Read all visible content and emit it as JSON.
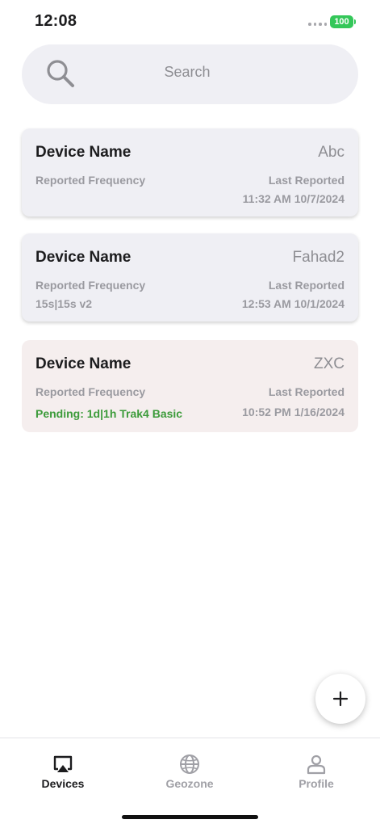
{
  "status_bar": {
    "time": "12:08",
    "battery": "100"
  },
  "search": {
    "placeholder": "Search"
  },
  "devices": [
    {
      "title": "Device Name",
      "name": "Abc",
      "frequency_label": "Reported Frequency",
      "frequency_value": "",
      "last_label": "Last Reported",
      "last_value": "11:32 AM 10/7/2024"
    },
    {
      "title": "Device Name",
      "name": "Fahad2",
      "frequency_label": "Reported Frequency",
      "frequency_value": "15s|15s v2",
      "last_label": "Last Reported",
      "last_value": "12:53 AM 10/1/2024"
    },
    {
      "title": "Device Name",
      "name": "ZXC",
      "frequency_label": "Reported Frequency",
      "frequency_value": "Pending: 1d|1h Trak4 Basic",
      "last_label": "Last Reported",
      "last_value": "10:52 PM 1/16/2024",
      "pending": true
    }
  ],
  "tabs": [
    {
      "label": "Devices",
      "icon": "airplay-icon",
      "active": true
    },
    {
      "label": "Geozone",
      "icon": "globe-icon",
      "active": false
    },
    {
      "label": "Profile",
      "icon": "person-icon",
      "active": false
    }
  ],
  "colors": {
    "pending_green": "#3c9b3a",
    "battery_green": "#34c759",
    "card_bg": "#efeff4",
    "pending_card_bg": "#f5eeee"
  }
}
